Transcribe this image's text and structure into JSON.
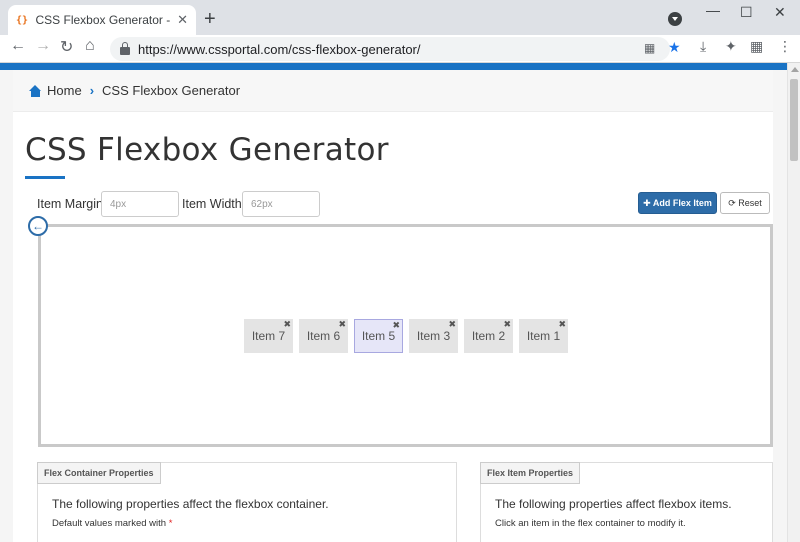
{
  "browser": {
    "tab_title": "CSS Flexbox Generator - CSS Portal",
    "tab_favicon": "{}",
    "tab_close": "✕",
    "new_tab": "+",
    "url": "https://www.cssportal.com/css-flexbox-generator/"
  },
  "breadcrumb": {
    "home": "Home",
    "separator": "›",
    "current": "CSS Flexbox Generator"
  },
  "page": {
    "title": "CSS Flexbox Generator"
  },
  "controls": {
    "item_margin_label": "Item Margin",
    "item_margin_value": "4px",
    "item_width_label": "Item Width",
    "item_width_value": "62px",
    "add_button": "✚ Add Flex Item",
    "reset_button": "⟳ Reset"
  },
  "flex_items": [
    "Item 7",
    "Item 6",
    "Item 5",
    "Item 3",
    "Item 2",
    "Item 1"
  ],
  "selected_item": "Item 5",
  "panels": {
    "container": {
      "tab": "Flex Container Properties",
      "text": "The following properties affect the flexbox container.",
      "sub": "Default values marked with",
      "star": "*"
    },
    "item": {
      "tab": "Flex Item Properties",
      "text": "The following properties affect flexbox items.",
      "sub": "Click an item in the flex container to modify it."
    }
  },
  "colors": {
    "accent": "#1a73c4",
    "button_primary": "#2d6ca8"
  }
}
